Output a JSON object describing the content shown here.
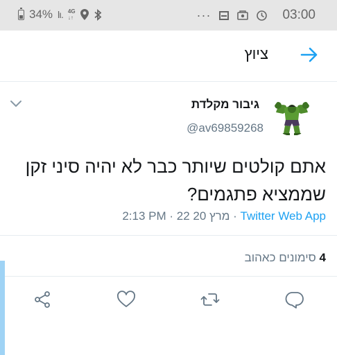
{
  "status_bar": {
    "battery": "34%",
    "network": [
      "4G",
      "↓↑"
    ],
    "time": "03:00",
    "icons": [
      "battery-icon",
      "signal-icon",
      "network-icon",
      "location-icon",
      "bluetooth-icon",
      "more-icon",
      "notification-icon",
      "sim-icon",
      "clock-icon"
    ]
  },
  "header": {
    "title": "ציוץ",
    "back_icon": "arrow-right-icon"
  },
  "tweet": {
    "display_name": "גיבור מקלדת",
    "handle": "@av69859268",
    "text": "אתם קולטים שיותר כבר לא יהיה סיני זקן שממציא פתגמים?",
    "time": "2:13 PM",
    "date": "22 מרץ 20",
    "separator": "·",
    "source": "Twitter Web App",
    "likes_count": "4",
    "likes_label": "סימונים כאהוב"
  },
  "actions": [
    "share-icon",
    "like-icon",
    "retweet-icon",
    "reply-icon"
  ],
  "colors": {
    "accent": "#1da1f2",
    "muted": "#657786",
    "text": "#14171a",
    "status_bar_bg": "#e6e6e6",
    "divider": "#e6ecf0"
  }
}
